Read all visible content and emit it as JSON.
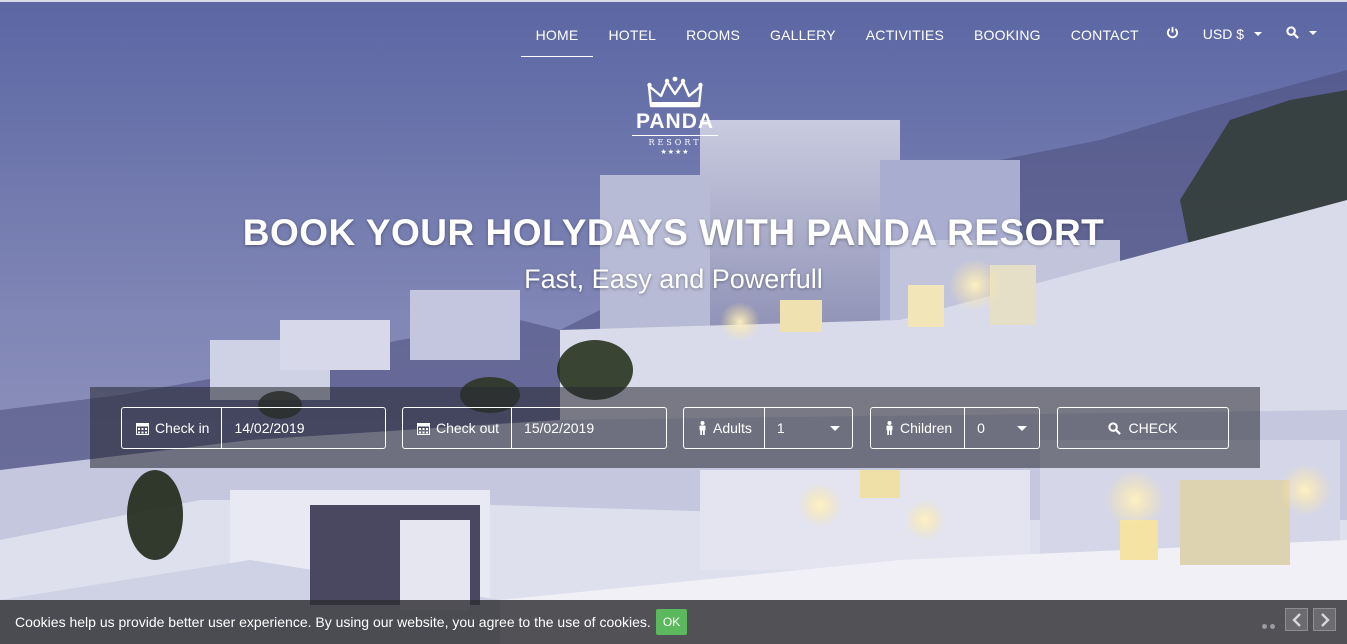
{
  "nav": {
    "items": [
      {
        "label": "HOME",
        "active": true
      },
      {
        "label": "HOTEL",
        "active": false
      },
      {
        "label": "ROOMS",
        "active": false
      },
      {
        "label": "GALLERY",
        "active": false
      },
      {
        "label": "ACTIVITIES",
        "active": false
      },
      {
        "label": "BOOKING",
        "active": false
      },
      {
        "label": "CONTACT",
        "active": false
      }
    ],
    "power_icon": "power-icon",
    "currency_label": "USD $",
    "search_icon": "search-icon"
  },
  "logo": {
    "name": "PANDA",
    "subtitle": "RESORT",
    "stars": "★★★★",
    "icon": "crown-icon"
  },
  "hero": {
    "title": "BOOK YOUR HOLYDAYS WITH PANDA RESORT",
    "subtitle": "Fast, Easy and Powerfull"
  },
  "booking": {
    "checkin": {
      "label": "Check in",
      "value": "14/02/2019",
      "icon": "calendar-icon"
    },
    "checkout": {
      "label": "Check out",
      "value": "15/02/2019",
      "icon": "calendar-icon"
    },
    "adults": {
      "label": "Adults",
      "value": "1",
      "icon": "person-icon"
    },
    "children": {
      "label": "Children",
      "value": "0",
      "icon": "person-icon"
    },
    "check_button": "CHECK"
  },
  "cookie": {
    "text": "Cookies help us provide better user experience. By using our website, you agree to the use of cookies.",
    "ok_label": "OK"
  },
  "colors": {
    "accent_ok": "#5cb85c",
    "overlay": "#282832"
  }
}
